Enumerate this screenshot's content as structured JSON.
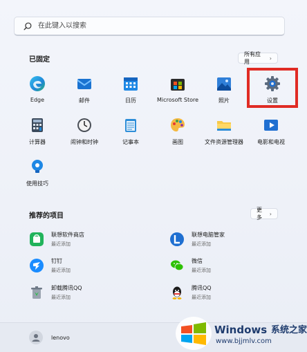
{
  "search": {
    "placeholder": "在此键入以搜索"
  },
  "pinned": {
    "title": "已固定",
    "all_apps_label": "所有应用",
    "apps": [
      {
        "label": "Edge",
        "icon": "edge-icon"
      },
      {
        "label": "邮件",
        "icon": "mail-icon"
      },
      {
        "label": "日历",
        "icon": "calendar-icon"
      },
      {
        "label": "Microsoft Store",
        "icon": "store-icon"
      },
      {
        "label": "照片",
        "icon": "photos-icon"
      },
      {
        "label": "设置",
        "icon": "settings-icon"
      },
      {
        "label": "计算器",
        "icon": "calculator-icon"
      },
      {
        "label": "闹钟和时钟",
        "icon": "clock-icon"
      },
      {
        "label": "记事本",
        "icon": "notepad-icon"
      },
      {
        "label": "画图",
        "icon": "paint-icon"
      },
      {
        "label": "文件资源管理器",
        "icon": "folder-icon"
      },
      {
        "label": "电影和电视",
        "icon": "movies-icon"
      },
      {
        "label": "使用技巧",
        "icon": "tips-icon"
      }
    ]
  },
  "recommended": {
    "title": "推荐的项目",
    "more_label": "更多",
    "items": [
      {
        "name": "联想软件商店",
        "sub": "最近添加",
        "icon": "lenovo-store-icon"
      },
      {
        "name": "联想电脑管家",
        "sub": "最近添加",
        "icon": "lenovo-manager-icon"
      },
      {
        "name": "钉钉",
        "sub": "最近添加",
        "icon": "dingtalk-icon"
      },
      {
        "name": "微信",
        "sub": "最近添加",
        "icon": "wechat-icon"
      },
      {
        "name": "卸载腾讯QQ",
        "sub": "最近添加",
        "icon": "uninstall-icon"
      },
      {
        "name": "腾讯QQ",
        "sub": "最近添加",
        "icon": "qq-icon"
      }
    ]
  },
  "user": {
    "name": "lenovo"
  },
  "watermark": {
    "brand": "Windows",
    "suffix": "系统之家",
    "url": "www.bjjmlv.com"
  }
}
